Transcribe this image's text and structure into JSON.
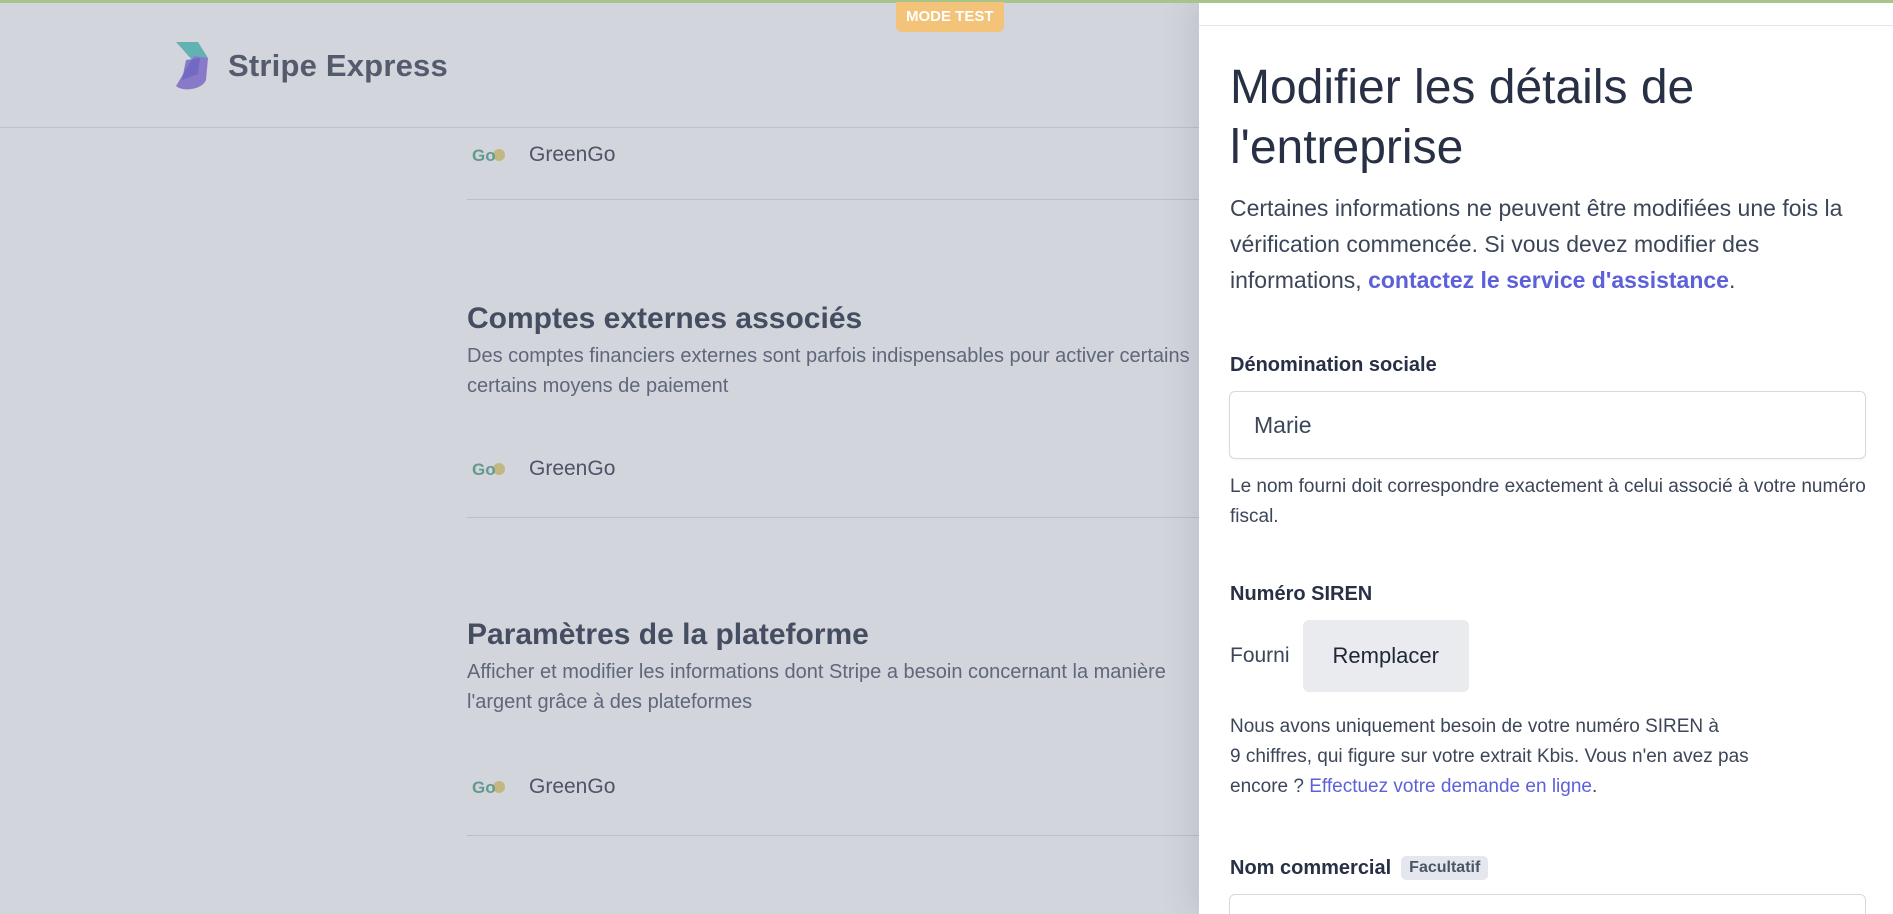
{
  "header": {
    "brand": "Stripe Express",
    "mode_badge": "MODE TEST"
  },
  "background": {
    "rows": [
      {
        "logo_text": "Go",
        "name": "GreenGo"
      },
      {
        "logo_text": "Go",
        "name": "GreenGo"
      },
      {
        "logo_text": "Go",
        "name": "GreenGo"
      }
    ],
    "sections": [
      {
        "title": "Comptes externes associés",
        "desc_line1": "Des comptes financiers externes sont parfois indispensables pour activer certains",
        "desc_line2": "certains moyens de paiement"
      },
      {
        "title": "Paramètres de la plateforme",
        "desc_line1": "Afficher et modifier les informations dont Stripe a besoin concernant la manière",
        "desc_line2": "l'argent grâce à des plateformes"
      }
    ]
  },
  "drawer": {
    "title": "Modifier les détails de l'entreprise",
    "intro_text": "Certaines informations ne peuvent être modifiées une fois la vérification commencée. Si vous devez modifier des informations, ",
    "intro_link": "contactez le service d'assistance",
    "intro_end": ".",
    "company_name": {
      "label": "Dénomination sociale",
      "value": "Marie",
      "help": "Le nom fourni doit correspondre exactement à celui associé à votre numéro fiscal."
    },
    "siren": {
      "label": "Numéro SIREN",
      "status": "Fourni",
      "button": "Remplacer",
      "help_line1": "Nous avons uniquement besoin de votre numéro SIREN à",
      "help_line2": "9 chiffres, qui figure sur votre extrait Kbis. Vous n'en avez pas",
      "help_line3_start": "encore ? ",
      "help_link": "Effectuez votre demande en ligne",
      "help_end": "."
    },
    "trade_name": {
      "label": "Nom commercial",
      "badge": "Facultatif"
    }
  },
  "colors": {
    "accent_link": "#5d61d9",
    "mode_badge": "#f3c37a",
    "title_text": "#283046"
  }
}
